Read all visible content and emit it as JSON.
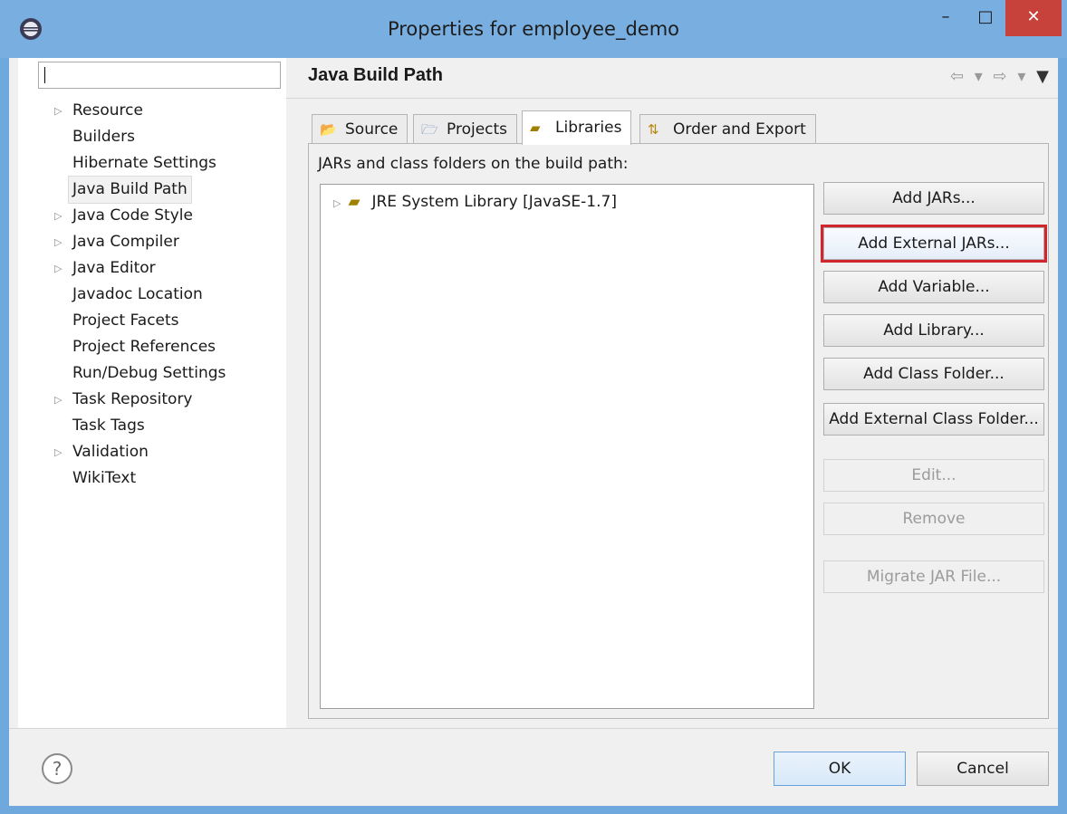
{
  "window": {
    "title": "Properties for employee_demo",
    "minimize_glyph": "–",
    "maximize_glyph": "□",
    "close_glyph": "✕"
  },
  "sidebar": {
    "filter_value": "",
    "items": [
      {
        "label": "Resource",
        "expandable": true
      },
      {
        "label": "Builders",
        "expandable": false
      },
      {
        "label": "Hibernate Settings",
        "expandable": false
      },
      {
        "label": "Java Build Path",
        "expandable": false,
        "selected": true
      },
      {
        "label": "Java Code Style",
        "expandable": true
      },
      {
        "label": "Java Compiler",
        "expandable": true
      },
      {
        "label": "Java Editor",
        "expandable": true
      },
      {
        "label": "Javadoc Location",
        "expandable": false
      },
      {
        "label": "Project Facets",
        "expandable": false
      },
      {
        "label": "Project References",
        "expandable": false
      },
      {
        "label": "Run/Debug Settings",
        "expandable": false
      },
      {
        "label": "Task Repository",
        "expandable": true
      },
      {
        "label": "Task Tags",
        "expandable": false
      },
      {
        "label": "Validation",
        "expandable": true
      },
      {
        "label": "WikiText",
        "expandable": false
      }
    ]
  },
  "main": {
    "title": "Java Build Path",
    "nav": {
      "back": "⇦",
      "back_menu": "▾",
      "forward": "⇨",
      "forward_menu": "▾",
      "view_menu": "▼"
    },
    "tabs": [
      {
        "label": "Source",
        "icon": "source-folder-icon",
        "glyph": "📂"
      },
      {
        "label": "Projects",
        "icon": "projects-folder-icon",
        "glyph": "🗁"
      },
      {
        "label": "Libraries",
        "icon": "library-icon",
        "glyph": "▰"
      },
      {
        "label": "Order and Export",
        "icon": "order-export-icon",
        "glyph": "⇅"
      }
    ],
    "active_tab": "Libraries",
    "section_label": "JARs and class folders on the build path:",
    "libraries": [
      {
        "label": "JRE System Library [JavaSE-1.7]",
        "icon": "jre-library-icon"
      }
    ],
    "buttons": [
      {
        "label": "Add JARs...",
        "enabled": true
      },
      {
        "label": "Add External JARs...",
        "enabled": true,
        "highlighted": true
      },
      {
        "label": "Add Variable...",
        "enabled": true
      },
      {
        "label": "Add Library...",
        "enabled": true
      },
      {
        "label": "Add Class Folder...",
        "enabled": true
      },
      {
        "label": "Add External Class Folder...",
        "enabled": true
      },
      {
        "label": "Edit...",
        "enabled": false
      },
      {
        "label": "Remove",
        "enabled": false
      },
      {
        "label": "Migrate JAR File...",
        "enabled": false
      }
    ]
  },
  "footer": {
    "help_glyph": "?",
    "ok_label": "OK",
    "cancel_label": "Cancel"
  },
  "colors": {
    "titlebar": "#79afe0",
    "close_button": "#c7423a",
    "highlight_outline": "#d0262d",
    "default_button_border": "#6aa3dc"
  }
}
